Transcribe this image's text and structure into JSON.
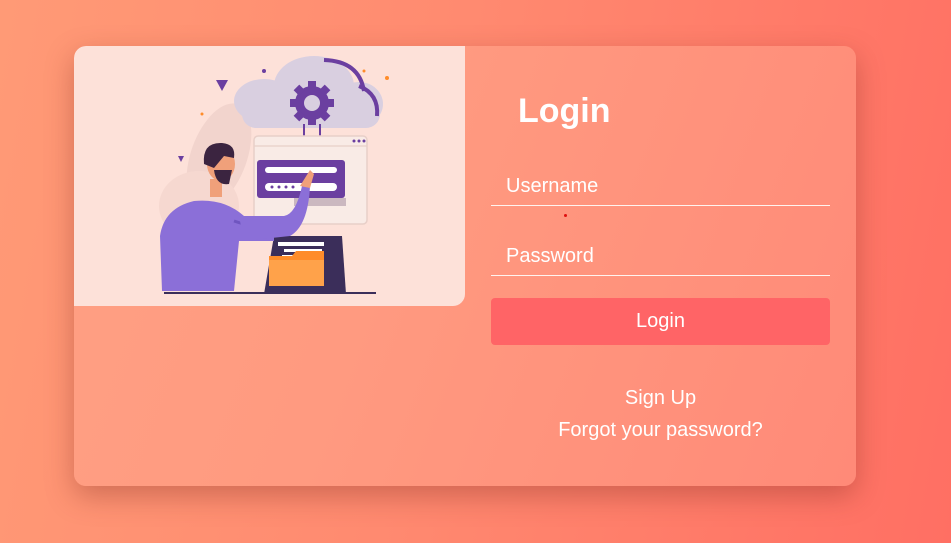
{
  "login": {
    "title": "Login",
    "username_placeholder": "Username",
    "password_placeholder": "Password",
    "login_button": "Login",
    "signup_link": "Sign Up",
    "forgot_link": "Forgot your password?"
  },
  "illustration": {
    "icon": "person-cloud-login-illustration"
  },
  "colors": {
    "background": "#ff8a70",
    "card": "#ff9a80",
    "illustration_bg": "#fde1d9",
    "button": "#ff6466",
    "accent_purple": "#6b3fa0",
    "folder_orange": "#ff8c2a"
  }
}
